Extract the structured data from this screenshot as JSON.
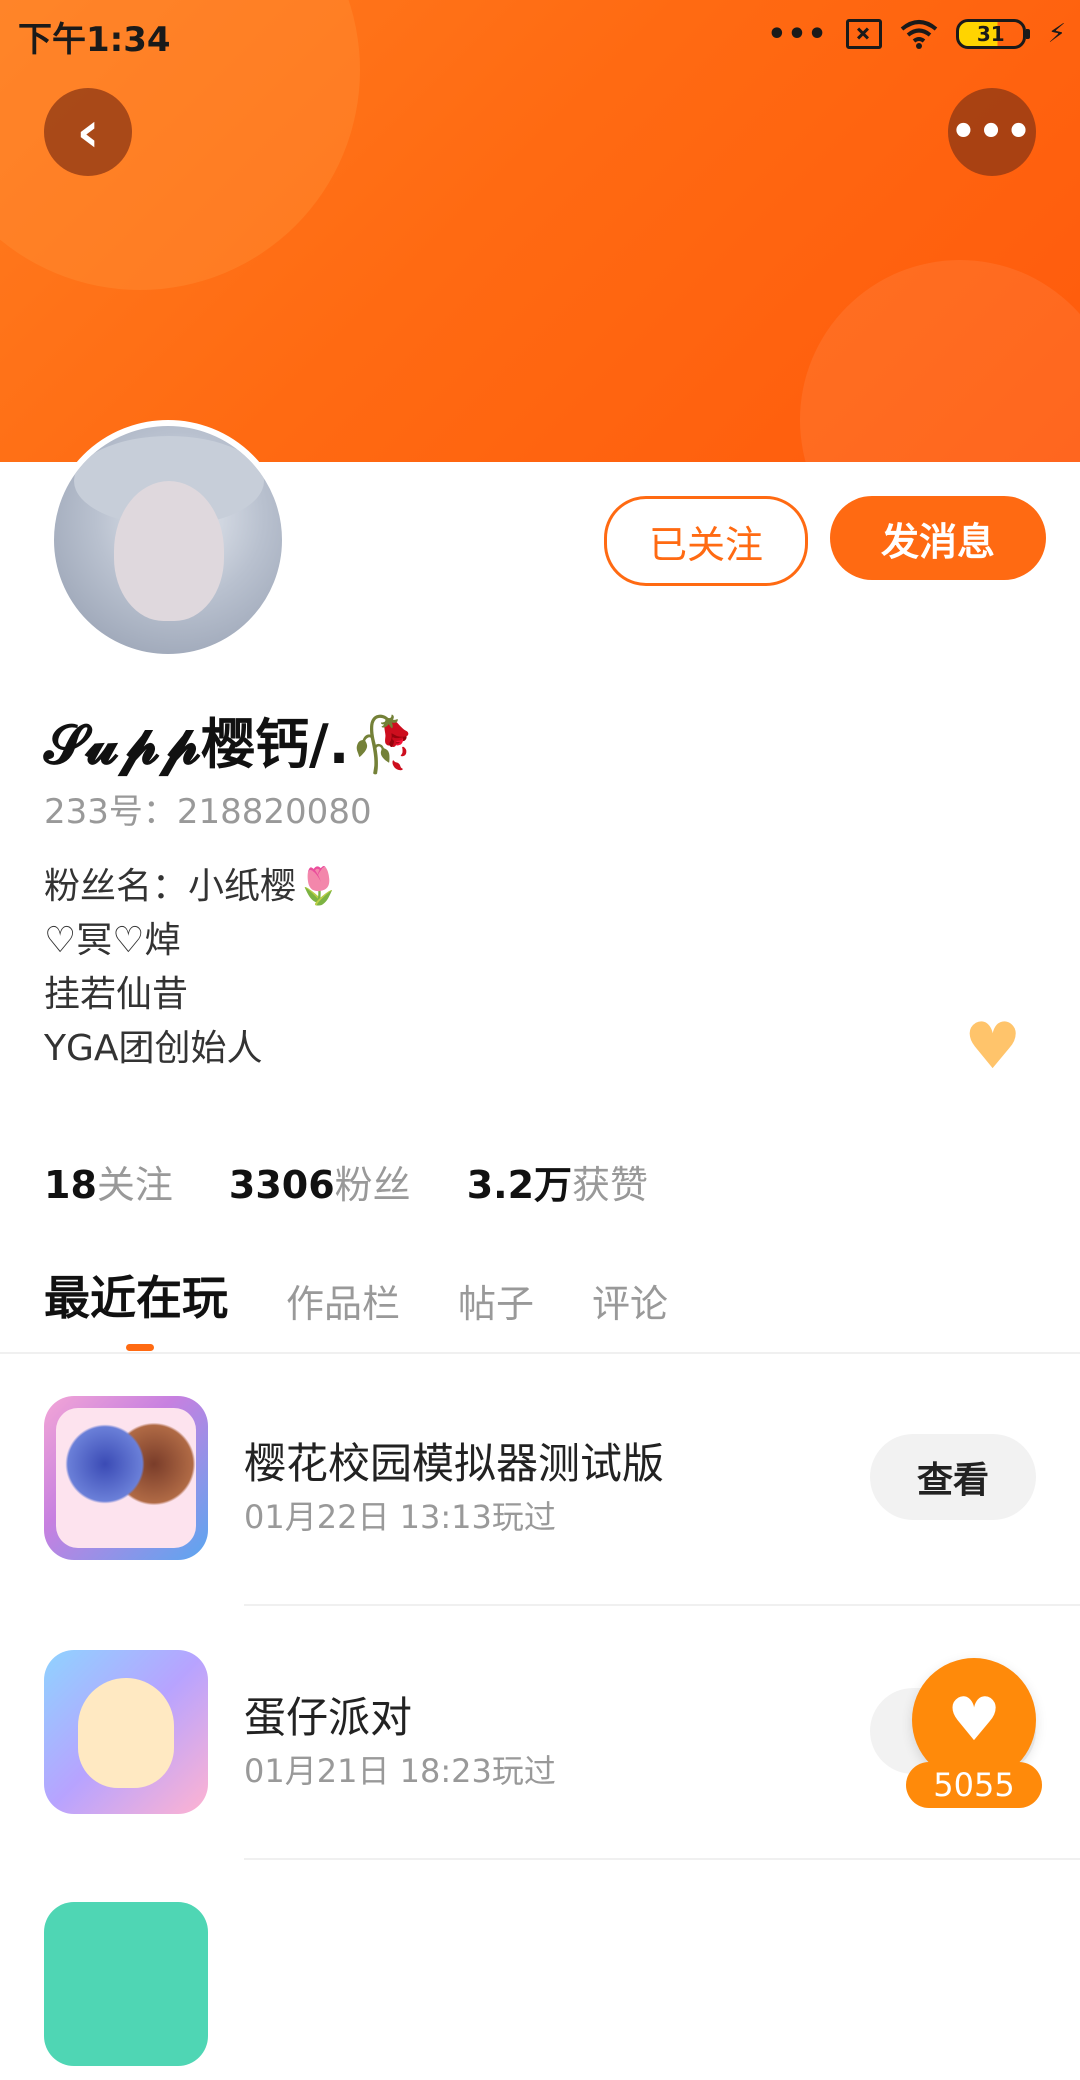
{
  "status_bar": {
    "time": "下午1:34",
    "battery": "31"
  },
  "profile": {
    "name": "𝓢𝓾𝓹𝓹樱钙/.🥀",
    "uid": "233号：218820080",
    "bio": [
      "粉丝名：小纸樱🌷",
      "♡冥♡焯",
      "挂若仙昔",
      "YGA团创始人"
    ]
  },
  "buttons": {
    "follow": "已关注",
    "message": "发消息"
  },
  "stats": [
    {
      "num": "18",
      "label": "关注"
    },
    {
      "num": "3306",
      "label": "粉丝"
    },
    {
      "num": "3.2万",
      "label": "获赞"
    }
  ],
  "tabs": [
    "最近在玩",
    "作品栏",
    "帖子",
    "评论"
  ],
  "games": [
    {
      "title": "樱花校园模拟器测试版",
      "sub": "01月22日 13:13玩过",
      "action": "查看"
    },
    {
      "title": "蛋仔派对",
      "sub": "01月21日 18:23玩过",
      "action": "查看"
    }
  ],
  "float_like": {
    "count": "5055"
  },
  "colors": {
    "accent": "#ff6a12",
    "like": "#ff8a0a"
  }
}
